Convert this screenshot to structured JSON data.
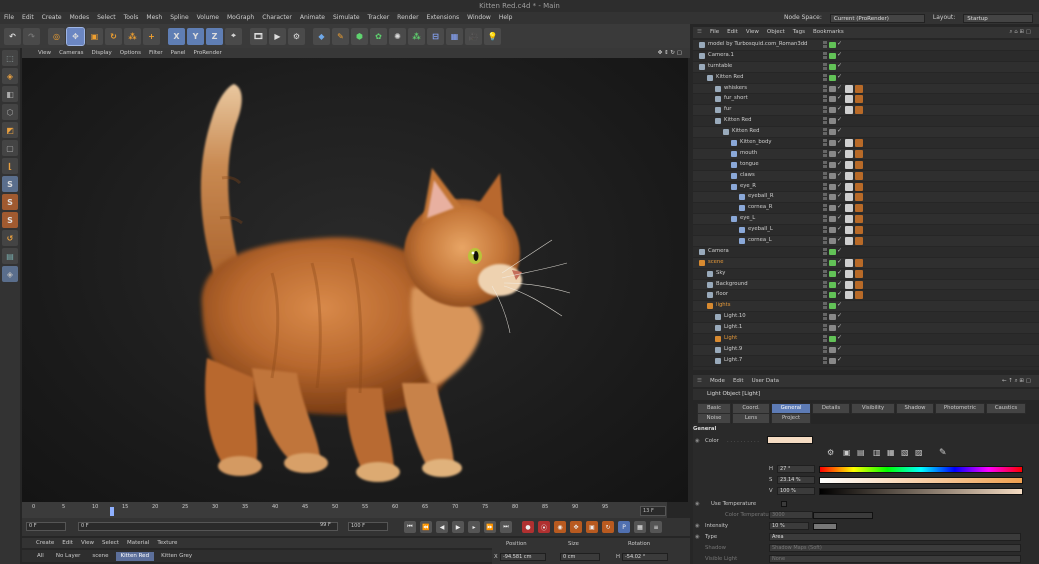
{
  "window": {
    "title": "Kitten Red.c4d * - Main"
  },
  "menubar": {
    "items": [
      "File",
      "Edit",
      "Create",
      "Modes",
      "Select",
      "Tools",
      "Mesh",
      "Spline",
      "Volume",
      "MoGraph",
      "Character",
      "Animate",
      "Simulate",
      "Tracker",
      "Render",
      "Extensions",
      "Window",
      "Help"
    ],
    "node_space_label": "Node Space:",
    "node_space_value": "Current (ProRender)",
    "layout_label": "Layout:",
    "layout_value": "Startup"
  },
  "toolbar": {
    "axis_x": "X",
    "axis_y": "Y",
    "axis_z": "Z"
  },
  "viewport": {
    "menu": [
      "View",
      "Cameras",
      "Display",
      "Options",
      "Filter",
      "Panel",
      "ProRender"
    ]
  },
  "timeline": {
    "ticks": [
      "0",
      "5",
      "10",
      "15",
      "20",
      "25",
      "30",
      "35",
      "40",
      "45",
      "50",
      "55",
      "60",
      "65",
      "70",
      "75",
      "80",
      "85",
      "90",
      "95"
    ],
    "current_frame": "13 F",
    "start_field": "0 F",
    "current_field": "0 F",
    "end_field": "99 F",
    "end_field2": "100 F"
  },
  "material_manager": {
    "menu": [
      "Create",
      "Edit",
      "View",
      "Select",
      "Material",
      "Texture"
    ],
    "filters": [
      "All",
      "No Layer",
      "scene",
      "Kitten Red",
      "Kitten Grey"
    ],
    "active_filter": "Kitten Red"
  },
  "coordinates": {
    "headers": [
      "Position",
      "Size",
      "Rotation"
    ],
    "x_label": "X",
    "position_x": "-94.581 cm",
    "size_x": "0 cm",
    "rotation_label": "H",
    "rotation_h": "-54.02 °"
  },
  "object_manager": {
    "menu": [
      "File",
      "Edit",
      "View",
      "Object",
      "Tags",
      "Bookmarks"
    ],
    "rows": [
      {
        "name": "model by Turbosquid.com_Roman3dd",
        "indent": 0,
        "color": "default"
      },
      {
        "name": "Camera.1",
        "indent": 0,
        "color": "default"
      },
      {
        "name": "turntable",
        "indent": 0,
        "color": "default"
      },
      {
        "name": "Kitten Red",
        "indent": 1,
        "color": "default"
      },
      {
        "name": "whiskers",
        "indent": 2,
        "color": "default"
      },
      {
        "name": "fur_short",
        "indent": 2,
        "color": "default"
      },
      {
        "name": "fur",
        "indent": 2,
        "color": "default"
      },
      {
        "name": "Kitten Red",
        "indent": 2,
        "color": "default"
      },
      {
        "name": "Kitten Red",
        "indent": 3,
        "color": "default"
      },
      {
        "name": "Kitten_body",
        "indent": 4,
        "color": "default"
      },
      {
        "name": "mouth",
        "indent": 4,
        "color": "default"
      },
      {
        "name": "tongue",
        "indent": 4,
        "color": "default"
      },
      {
        "name": "claws",
        "indent": 4,
        "color": "default"
      },
      {
        "name": "eye_R",
        "indent": 4,
        "color": "default"
      },
      {
        "name": "eyeball_R",
        "indent": 5,
        "color": "default"
      },
      {
        "name": "cornea_R",
        "indent": 5,
        "color": "default"
      },
      {
        "name": "eye_L",
        "indent": 4,
        "color": "default"
      },
      {
        "name": "eyeball_L",
        "indent": 5,
        "color": "default"
      },
      {
        "name": "cornea_L",
        "indent": 5,
        "color": "default"
      },
      {
        "name": "Camera",
        "indent": 0,
        "color": "default"
      },
      {
        "name": "scene",
        "indent": 0,
        "color": "orange"
      },
      {
        "name": "Sky",
        "indent": 1,
        "color": "default"
      },
      {
        "name": "Background",
        "indent": 1,
        "color": "default"
      },
      {
        "name": "floor",
        "indent": 1,
        "color": "default"
      },
      {
        "name": "lights",
        "indent": 1,
        "color": "orange"
      },
      {
        "name": "Light.10",
        "indent": 2,
        "color": "default"
      },
      {
        "name": "Light.1",
        "indent": 2,
        "color": "default"
      },
      {
        "name": "Light",
        "indent": 2,
        "color": "orange"
      },
      {
        "name": "Light.9",
        "indent": 2,
        "color": "default"
      },
      {
        "name": "Light.7",
        "indent": 2,
        "color": "default"
      }
    ]
  },
  "attribute_manager": {
    "menu": [
      "Mode",
      "Edit",
      "User Data"
    ],
    "object_title": "Light Object [Light]",
    "tabs_row1": [
      "Basic",
      "Coord.",
      "General",
      "Details",
      "Visibility",
      "Shadow",
      "Photometric",
      "Caustics"
    ],
    "tabs_row2": [
      "Noise",
      "Lens",
      "Project"
    ],
    "active_tab": "General",
    "section": "General",
    "color_label": "Color",
    "h_label": "H",
    "h_value": "27 °",
    "s_label": "S",
    "s_value": "23.14 %",
    "v_label": "V",
    "v_value": "100 %",
    "use_temp_label": "Use Temperature",
    "color_temp_label": "Color Temperature",
    "color_temp_value": "3000",
    "intensity_label": "Intensity",
    "intensity_value": "10 %",
    "type_label": "Type",
    "type_value": "Area",
    "shadow_label": "Shadow",
    "shadow_value": "Shadow Maps (Soft)",
    "visible_light_label": "Visible Light",
    "visible_light_value": "None",
    "swatch_color": "#f5dcc3"
  }
}
